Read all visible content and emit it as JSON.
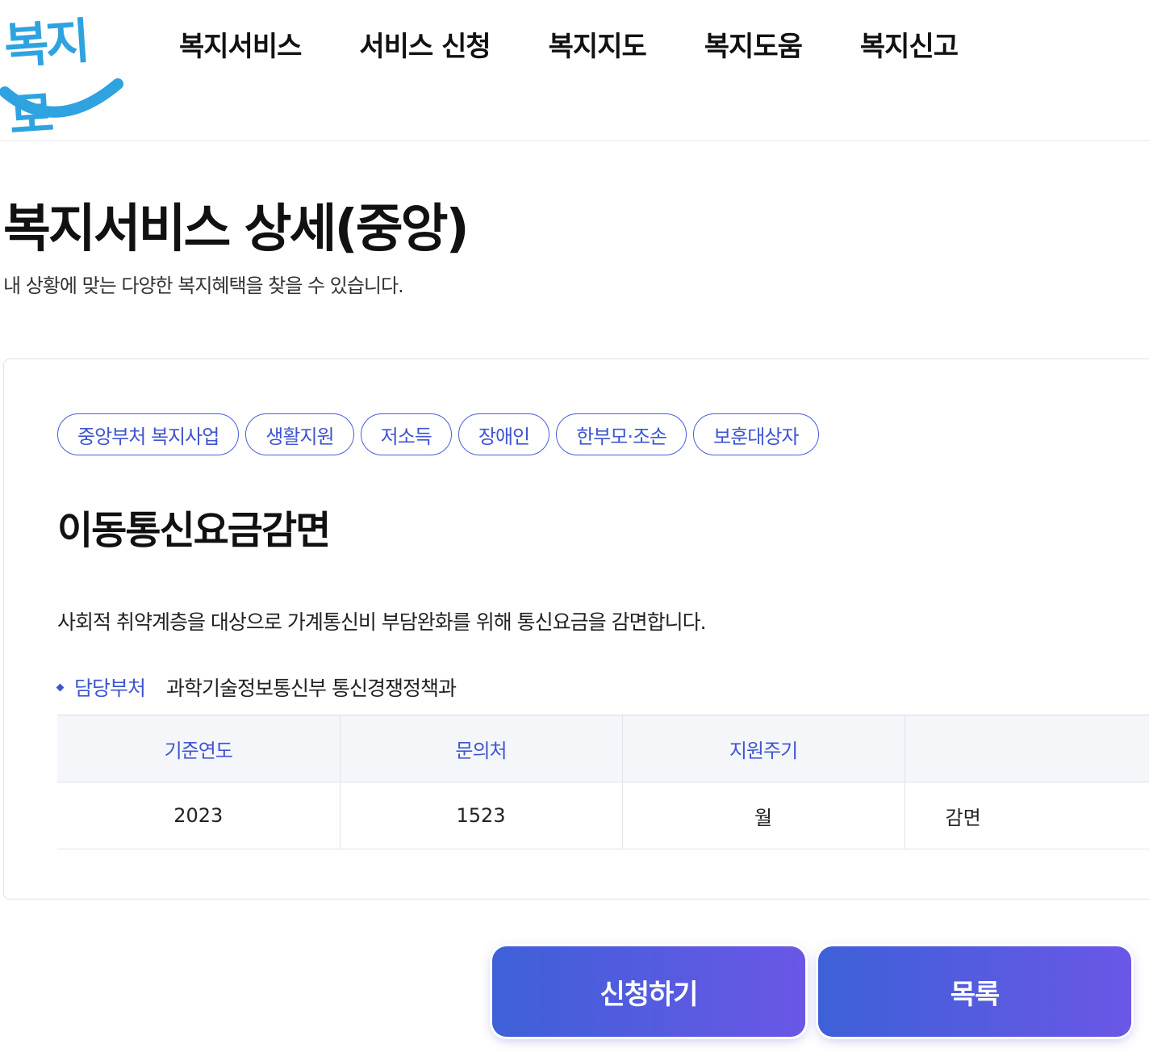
{
  "logo": {
    "text": "복지로",
    "accent_color": "#2fa2e0"
  },
  "nav": {
    "items": [
      {
        "label": "복지서비스"
      },
      {
        "label": "서비스 신청"
      },
      {
        "label": "복지지도"
      },
      {
        "label": "복지도움"
      },
      {
        "label": "복지신고"
      }
    ]
  },
  "page": {
    "title": "복지서비스 상세(중앙)",
    "subtitle": "내 상황에 맞는 다양한 복지혜택을 찾을 수 있습니다."
  },
  "service": {
    "tags": [
      "중앙부처 복지사업",
      "생활지원",
      "저소득",
      "장애인",
      "한부모·조손",
      "보훈대상자"
    ],
    "title": "이동통신요금감면",
    "description": "사회적 취약계층을 대상으로 가계통신비 부담완화를 위해 통신요금을 감면합니다.",
    "department_label": "담당부처",
    "department": "과학기술정보통신부 통신경쟁정책과",
    "table": {
      "headers": [
        "기준연도",
        "문의처",
        "지원주기",
        ""
      ],
      "row": [
        "2023",
        "1523",
        "월",
        "감면"
      ]
    }
  },
  "buttons": {
    "apply": "신청하기",
    "list": "목록"
  },
  "colors": {
    "accent": "#3f55d0",
    "button_gradient_start": "#3d60d8",
    "button_gradient_end": "#6a57e6"
  }
}
